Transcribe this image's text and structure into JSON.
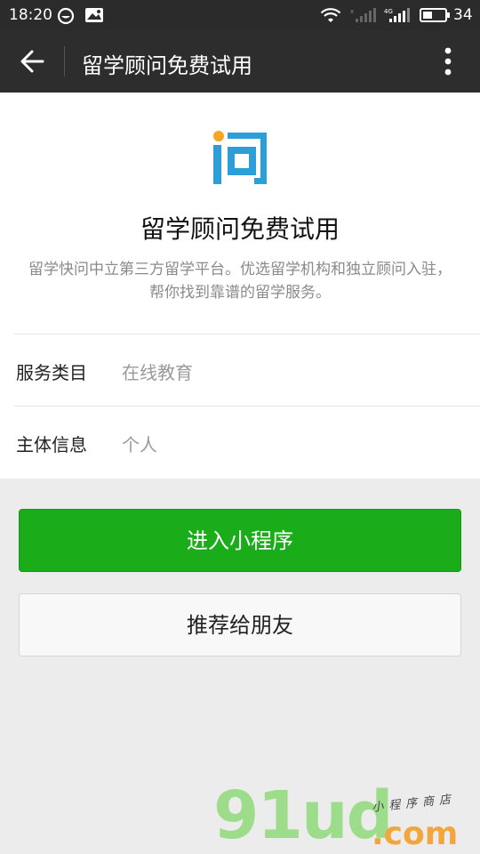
{
  "status_bar": {
    "time": "18:20",
    "battery": "34",
    "icons": [
      "message-circle-icon",
      "image-notification-icon",
      "wifi-icon",
      "signal-icon",
      "4g-signal-icon",
      "battery-icon"
    ]
  },
  "app_bar": {
    "title": "留学顾问免费试用",
    "back_icon": "back-arrow-icon",
    "menu_icon": "more-vertical-icon"
  },
  "profile": {
    "name": "留学顾问免费试用",
    "description": "留学快问中立第三方留学平台。优选留学机构和独立顾问入驻，帮你找到靠谱的留学服务。",
    "logo_colors": {
      "primary": "#2c9ed8",
      "dot": "#f5a623"
    }
  },
  "info_rows": [
    {
      "label": "服务类目",
      "value": "在线教育"
    },
    {
      "label": "主体信息",
      "value": "个人"
    }
  ],
  "actions": {
    "enter_label": "进入小程序",
    "recommend_label": "推荐给朋友"
  },
  "watermark": {
    "brand": "91ud",
    "domain": ".com",
    "subtitle": "小程序商店"
  },
  "colors": {
    "primary_green": "#1aad19",
    "header_bg": "#2d2d2d",
    "page_bg": "#ececec"
  }
}
